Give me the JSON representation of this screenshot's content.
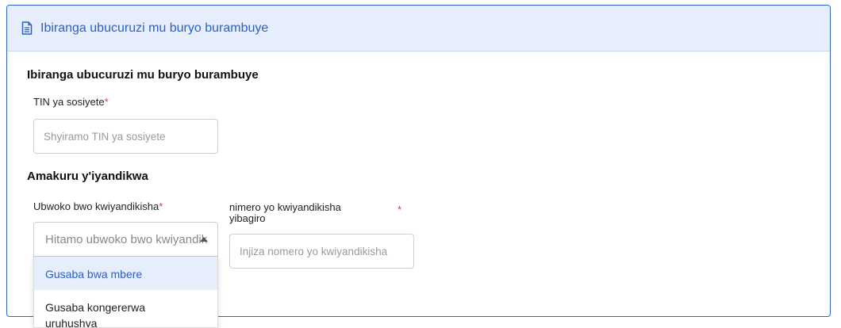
{
  "card": {
    "header_title": "Ibiranga ubucuruzi mu buryo burambuye",
    "header_icon": "document-icon"
  },
  "section1": {
    "title": "Ibiranga ubucuruzi mu buryo burambuye",
    "tin_label": "TIN ya sosiyete",
    "tin_required": "*",
    "tin_placeholder": "Shyiramo TIN ya sosiyete"
  },
  "section2": {
    "title": "Amakuru y'iyandikwa",
    "reg_type_label": "Ubwoko bwo kwiyandikisha",
    "reg_type_required": "*",
    "reg_type_placeholder": "Hitamo ubwoko bwo kwiyandikisha",
    "reg_number_label": "nimero yo kwiyandikisha yibagiro",
    "reg_number_required": "*",
    "reg_number_placeholder": "Injiza nomero yo kwiyandikisha",
    "options": [
      {
        "label": "Gusaba bwa mbere"
      },
      {
        "label": "Gusaba kongererwa uruhushya"
      }
    ]
  },
  "colors": {
    "accent": "#2d63d6",
    "header_bg": "#e6eefc",
    "required": "#d33b3b"
  }
}
